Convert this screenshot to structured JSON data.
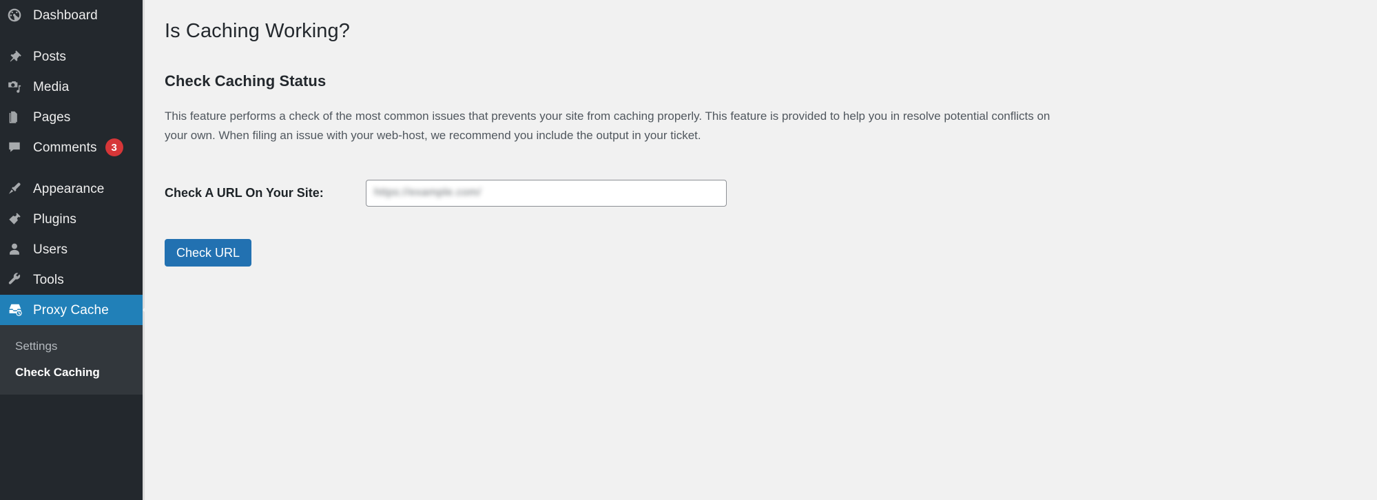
{
  "sidebar": {
    "items": [
      {
        "label": "Dashboard",
        "icon": "dashboard-icon",
        "badge": null
      },
      {
        "label": "Posts",
        "icon": "pin-icon",
        "badge": null
      },
      {
        "label": "Media",
        "icon": "media-icon",
        "badge": null
      },
      {
        "label": "Pages",
        "icon": "pages-icon",
        "badge": null
      },
      {
        "label": "Comments",
        "icon": "comments-icon",
        "badge": "3"
      },
      {
        "label": "Appearance",
        "icon": "brush-icon",
        "badge": null
      },
      {
        "label": "Plugins",
        "icon": "plug-icon",
        "badge": null
      },
      {
        "label": "Users",
        "icon": "user-icon",
        "badge": null
      },
      {
        "label": "Tools",
        "icon": "wrench-icon",
        "badge": null
      },
      {
        "label": "Proxy Cache",
        "icon": "proxy-cache-icon",
        "badge": null
      }
    ],
    "submenu": [
      {
        "label": "Settings",
        "active": false
      },
      {
        "label": "Check Caching",
        "active": true
      }
    ]
  },
  "main": {
    "page_title": "Is Caching Working?",
    "section_title": "Check Caching Status",
    "description": "This feature performs a check of the most common issues that prevents your site from caching properly. This feature is provided to help you in resolve potential conflicts on your own. When filing an issue with your web-host, we recommend you include the output in your ticket.",
    "form": {
      "url_label": "Check A URL On Your Site:",
      "url_value": "https://example.com/",
      "url_placeholder": "",
      "submit_label": "Check URL"
    }
  },
  "colors": {
    "sidebar_bg": "#23282d",
    "submenu_bg": "#32373c",
    "highlight": "#2180b8",
    "badge": "#d63638",
    "button": "#2271b1",
    "content_bg": "#f1f1f1"
  }
}
